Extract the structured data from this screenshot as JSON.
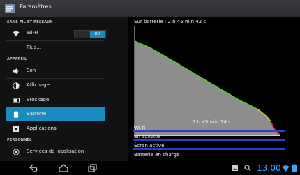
{
  "app": {
    "title": "Paramètres"
  },
  "sections": {
    "wireless": "SANS FIL ET RÉSEAUX",
    "device": "APPAREIL",
    "personal": "PERSONNEL"
  },
  "items": {
    "wifi": "Wi-Fi",
    "wifi_toggle": "OUI",
    "more": "Plus…",
    "sound": "Son",
    "display": "Affichage",
    "storage": "Stockage",
    "battery": "Batterie",
    "apps": "Applications",
    "location": "Services de localisation"
  },
  "battery": {
    "on_battery": "Sur batterie : 2 h 46 min 42 s",
    "duration": "2 h 49 min 24 s",
    "rows": [
      "Wi-Fi",
      "En activité",
      "Écran activé",
      "Batterie en charge"
    ]
  },
  "status": {
    "time": "13:00"
  },
  "colors": {
    "accent": "#1a8bbf",
    "bar": "#2a3ec8",
    "clock": "#36a6ff"
  }
}
